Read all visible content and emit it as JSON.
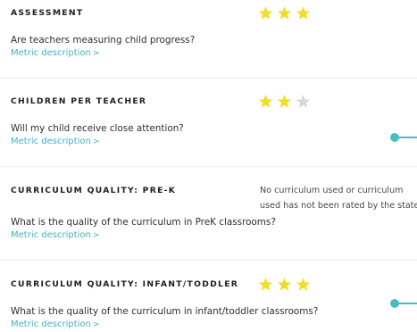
{
  "metrics": [
    {
      "title": "ASSESSMENT",
      "question": "Are teachers measuring child progress?",
      "link_label": "Metric description",
      "link_chevron": ">",
      "rating": 3,
      "max_rating": 3
    },
    {
      "title": "CHILDREN PER TEACHER",
      "question": "Will my child receive close attention?",
      "link_label": "Metric description",
      "link_chevron": ">",
      "rating": 2,
      "max_rating": 3
    },
    {
      "title": "CURRICULUM QUALITY: PRE-K",
      "question": "What is the quality of the curriculum in PreK classrooms?",
      "link_label": "Metric description",
      "link_chevron": ">",
      "note_line1": "No curriculum used or curriculum",
      "note_line2": "used has not been rated by the state"
    },
    {
      "title": "CURRICULUM QUALITY: INFANT/TODDLER",
      "question": "What is the quality of the curriculum in infant/toddler classrooms?",
      "link_label": "Metric description",
      "link_chevron": ">",
      "rating": 3,
      "max_rating": 3
    }
  ],
  "colors": {
    "star_filled": "#f2dc2a",
    "star_empty": "#d8d8d8",
    "link": "#3fb3c0",
    "toggle": "#48bcc4"
  },
  "icons": {
    "star": "star-icon",
    "toggle": "slider-handle-icon"
  }
}
